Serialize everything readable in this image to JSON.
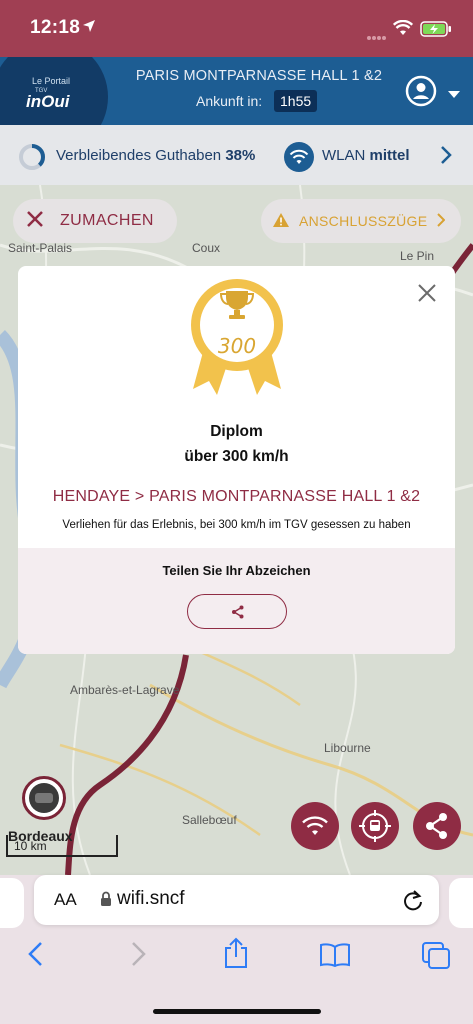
{
  "status_bar": {
    "time": "12:18"
  },
  "header": {
    "logo_line1": "Le Portail",
    "logo_line2": "TGV",
    "logo_line3": "inOui",
    "destination": "PARIS MONTPARNASSE HALL 1 &2",
    "arrival_label": "Ankunft in:",
    "arrival_time": "1h55"
  },
  "info_bar": {
    "credit_label": "Verbleibendes Guthaben",
    "credit_value": "38%",
    "credit_fraction": 0.38,
    "wlan_label": "WLAN",
    "wlan_value": "mittel"
  },
  "map": {
    "close_label": "ZUMACHEN",
    "connections_label": "ANSCHLUSSZÜGE",
    "places": [
      "Saint-Palais",
      "Coux",
      "Le Pin",
      "Ambarès-et-Lagrave",
      "Libourne",
      "Sallebœuf",
      "Bordeaux"
    ],
    "scale_label": "10 km"
  },
  "modal": {
    "medal_number": "300",
    "title": "Diplom",
    "subtitle": "über 300 km/h",
    "route": "HENDAYE > PARIS MONTPARNASSE HALL 1 &2",
    "description": "Verliehen für das Erlebnis, bei 300 km/h im TGV gesessen zu haben",
    "share_title": "Teilen Sie Ihr Abzeichen"
  },
  "browser": {
    "aa_label": "AA",
    "url": "wifi.sncf"
  },
  "colors": {
    "brand_red": "#8f2c44",
    "status_bar": "#a03f53",
    "header_blue": "#1d5d93",
    "medal_gold": "#f2c24c",
    "warning_amber": "#d8a233"
  },
  "icons": [
    "location-arrow-icon",
    "wifi-icon",
    "battery-charging-icon",
    "account-icon",
    "caret-down-icon",
    "wifi-icon",
    "chevron-right-icon",
    "close-icon",
    "warning-icon",
    "trophy-icon",
    "share-icon",
    "lock-icon",
    "reload-icon",
    "back-icon",
    "forward-icon",
    "upload-icon",
    "bookmarks-icon",
    "tabs-icon"
  ]
}
